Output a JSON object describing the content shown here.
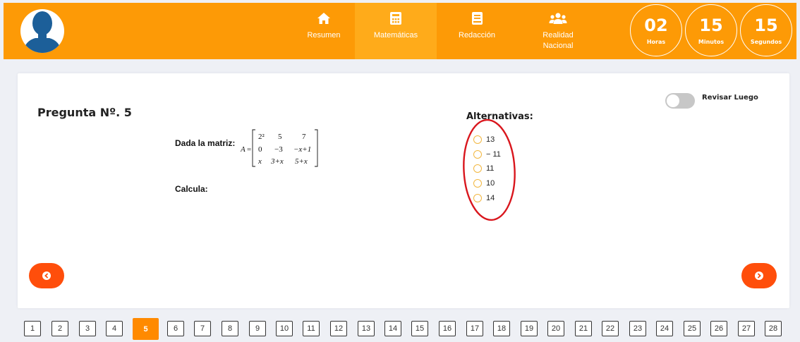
{
  "header": {
    "nav": [
      {
        "label": "Resumen",
        "icon": "home-icon"
      },
      {
        "label": "Matemáticas",
        "icon": "calculator-icon",
        "active": true
      },
      {
        "label": "Redacción",
        "icon": "book-icon"
      },
      {
        "label": "Realidad Nacional",
        "icon": "users-icon"
      }
    ],
    "timer": [
      {
        "value": "02",
        "unit": "Horas"
      },
      {
        "value": "15",
        "unit": "Minutos"
      },
      {
        "value": "15",
        "unit": "Segundos"
      }
    ]
  },
  "question": {
    "title": "Pregunta Nº. 5",
    "text": "Dada la matriz:",
    "matrix_name": "A",
    "matrix_eq": "=",
    "matrix": [
      [
        "2²",
        "5",
        "7"
      ],
      [
        "0",
        "−3",
        "−x+1"
      ],
      [
        "x",
        "3+x",
        "5+x"
      ]
    ],
    "calc": "Calcula:"
  },
  "alternatives": {
    "title": "Alternativas:",
    "options": [
      "13",
      "− 11",
      "11",
      "10",
      "14"
    ]
  },
  "review": {
    "label": "Revisar Luego",
    "enabled": false
  },
  "pagination": {
    "pages": [
      "1",
      "2",
      "3",
      "4",
      "5",
      "6",
      "7",
      "8",
      "9",
      "10",
      "11",
      "12",
      "13",
      "14",
      "15",
      "16",
      "17",
      "18",
      "19",
      "20",
      "21",
      "22",
      "23",
      "24",
      "25",
      "26",
      "27",
      "28"
    ],
    "current": 5
  },
  "colors": {
    "accent": "#fd9a06",
    "button": "#ff4e0b",
    "annotation": "#d9161d"
  }
}
